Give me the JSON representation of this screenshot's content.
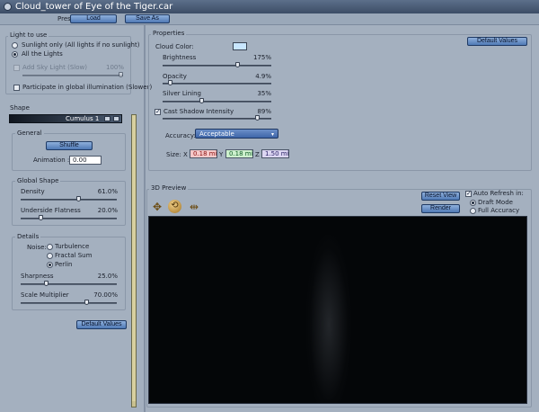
{
  "window": {
    "title": "Cloud_tower of Eye of the Tiger.car"
  },
  "preset": {
    "label": "Preset:",
    "load": "Load",
    "save_as": "Save As"
  },
  "light": {
    "title": "Light to use",
    "option_sunlight": "Sunlight only (All lights if no sunlight)",
    "option_all": "All the Lights",
    "selected": "All the Lights",
    "sky_light_label": "Add Sky Light (Slow)",
    "sky_light_value": "100%",
    "sky_light_level": 1.0,
    "global_illum_label": "Participate in global illumination (Slower)"
  },
  "shape": {
    "title": "Shape",
    "name": "Cumulus 1",
    "general": {
      "title": "General",
      "shuffle": "Shuffle",
      "animation_label": "Animation :",
      "animation_value": "0.00"
    },
    "global_shape": {
      "title": "Global Shape",
      "density_label": "Density",
      "density_value": "61.0%",
      "density_level": 0.61,
      "flatness_label": "Underside Flatness",
      "flatness_value": "20.0%",
      "flatness_level": 0.2
    },
    "details": {
      "title": "Details",
      "noise_label": "Noise:",
      "noise_options": [
        "Turbulence",
        "Fractal Sum",
        "Perlin"
      ],
      "noise_selected": "Perlin",
      "sharpness_label": "Sharpness",
      "sharpness_value": "25.0%",
      "sharpness_level": 0.25,
      "scale_label": "Scale Multiplier",
      "scale_value": "70.00%",
      "scale_level": 0.7
    },
    "default_values": "Default Values"
  },
  "properties": {
    "title": "Properties",
    "default_values": "Default Values",
    "cloud_color_label": "Cloud Color:",
    "cloud_color": "#c8e6ff",
    "brightness_label": "Brightness",
    "brightness_value": "175%",
    "brightness_level": 0.7,
    "opacity_label": "Opacity",
    "opacity_value": "4.9%",
    "opacity_level": 0.05,
    "silver_label": "Silver Lining",
    "silver_value": "35%",
    "silver_level": 0.35,
    "shadow_label": "Cast Shadow Intensity",
    "shadow_value": "89%",
    "shadow_level": 0.89,
    "shadow_checked": true,
    "accuracy_label": "Accuracy:",
    "accuracy_value": "Acceptable",
    "size_label": "Size:",
    "x_label": "X",
    "x_value": "0.18 mi",
    "y_label": "Y",
    "y_value": "0.18 mi",
    "z_label": "Z",
    "z_value": "1.50 mi"
  },
  "preview": {
    "title": "3D Preview",
    "reset_view": "Reset View",
    "render": "Render",
    "auto_refresh_label": "Auto Refresh in:",
    "auto_refresh_checked": true,
    "modes": [
      "Draft Mode",
      "Full Accuracy"
    ],
    "mode_selected": "Draft Mode",
    "tool_icons": [
      "move-icon",
      "rotate-icon",
      "zoom-icon"
    ]
  }
}
